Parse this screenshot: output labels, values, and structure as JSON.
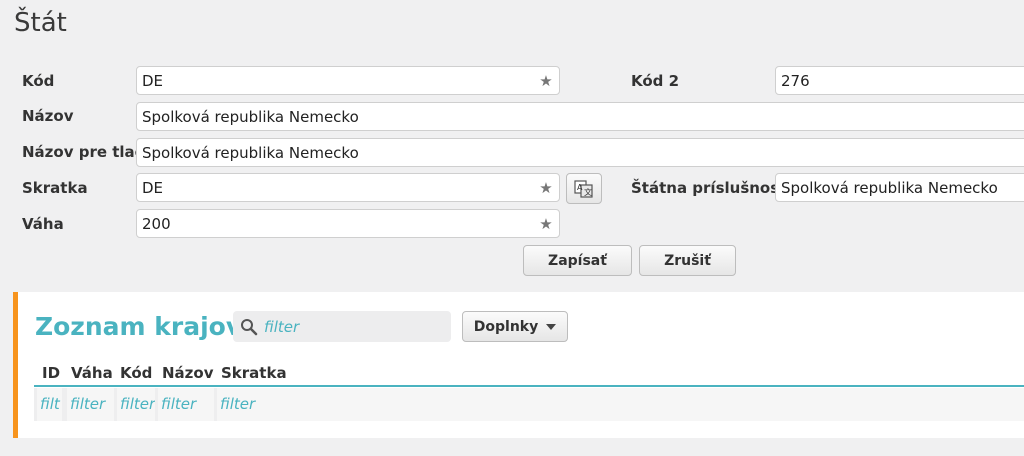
{
  "page": {
    "title": "Štát"
  },
  "form": {
    "code": {
      "label": "Kód",
      "value": "DE"
    },
    "code2": {
      "label": "Kód 2",
      "value": "276"
    },
    "name": {
      "label": "Názov",
      "value": "Spolková republika Nemecko"
    },
    "print_name": {
      "label": "Názov pre tlač",
      "value": "Spolková republika Nemecko"
    },
    "abbreviation": {
      "label": "Skratka",
      "value": "DE"
    },
    "nationality": {
      "label": "Štátna príslušnosť",
      "value": "Spolková republika Nemecko"
    },
    "weight": {
      "label": "Váha",
      "value": "200"
    }
  },
  "actions": {
    "save": "Zapísať",
    "cancel": "Zrušiť"
  },
  "regions": {
    "title": "Zoznam krajov",
    "search_placeholder": "filter",
    "addons_label": "Doplnky",
    "columns": [
      {
        "header": "ID",
        "filter": "filt"
      },
      {
        "header": "Váha",
        "filter": "filter"
      },
      {
        "header": "Kód",
        "filter": "filter"
      },
      {
        "header": "Názov",
        "filter": "filter"
      },
      {
        "header": "Skratka",
        "filter": "filter"
      }
    ]
  },
  "colors": {
    "accent": "#4ab3c0",
    "panel_marker": "#f7941d"
  },
  "icons": {
    "field_star": "star-icon",
    "translate": "translate-icon",
    "search": "search-icon",
    "dropdown": "caret-down-icon"
  }
}
